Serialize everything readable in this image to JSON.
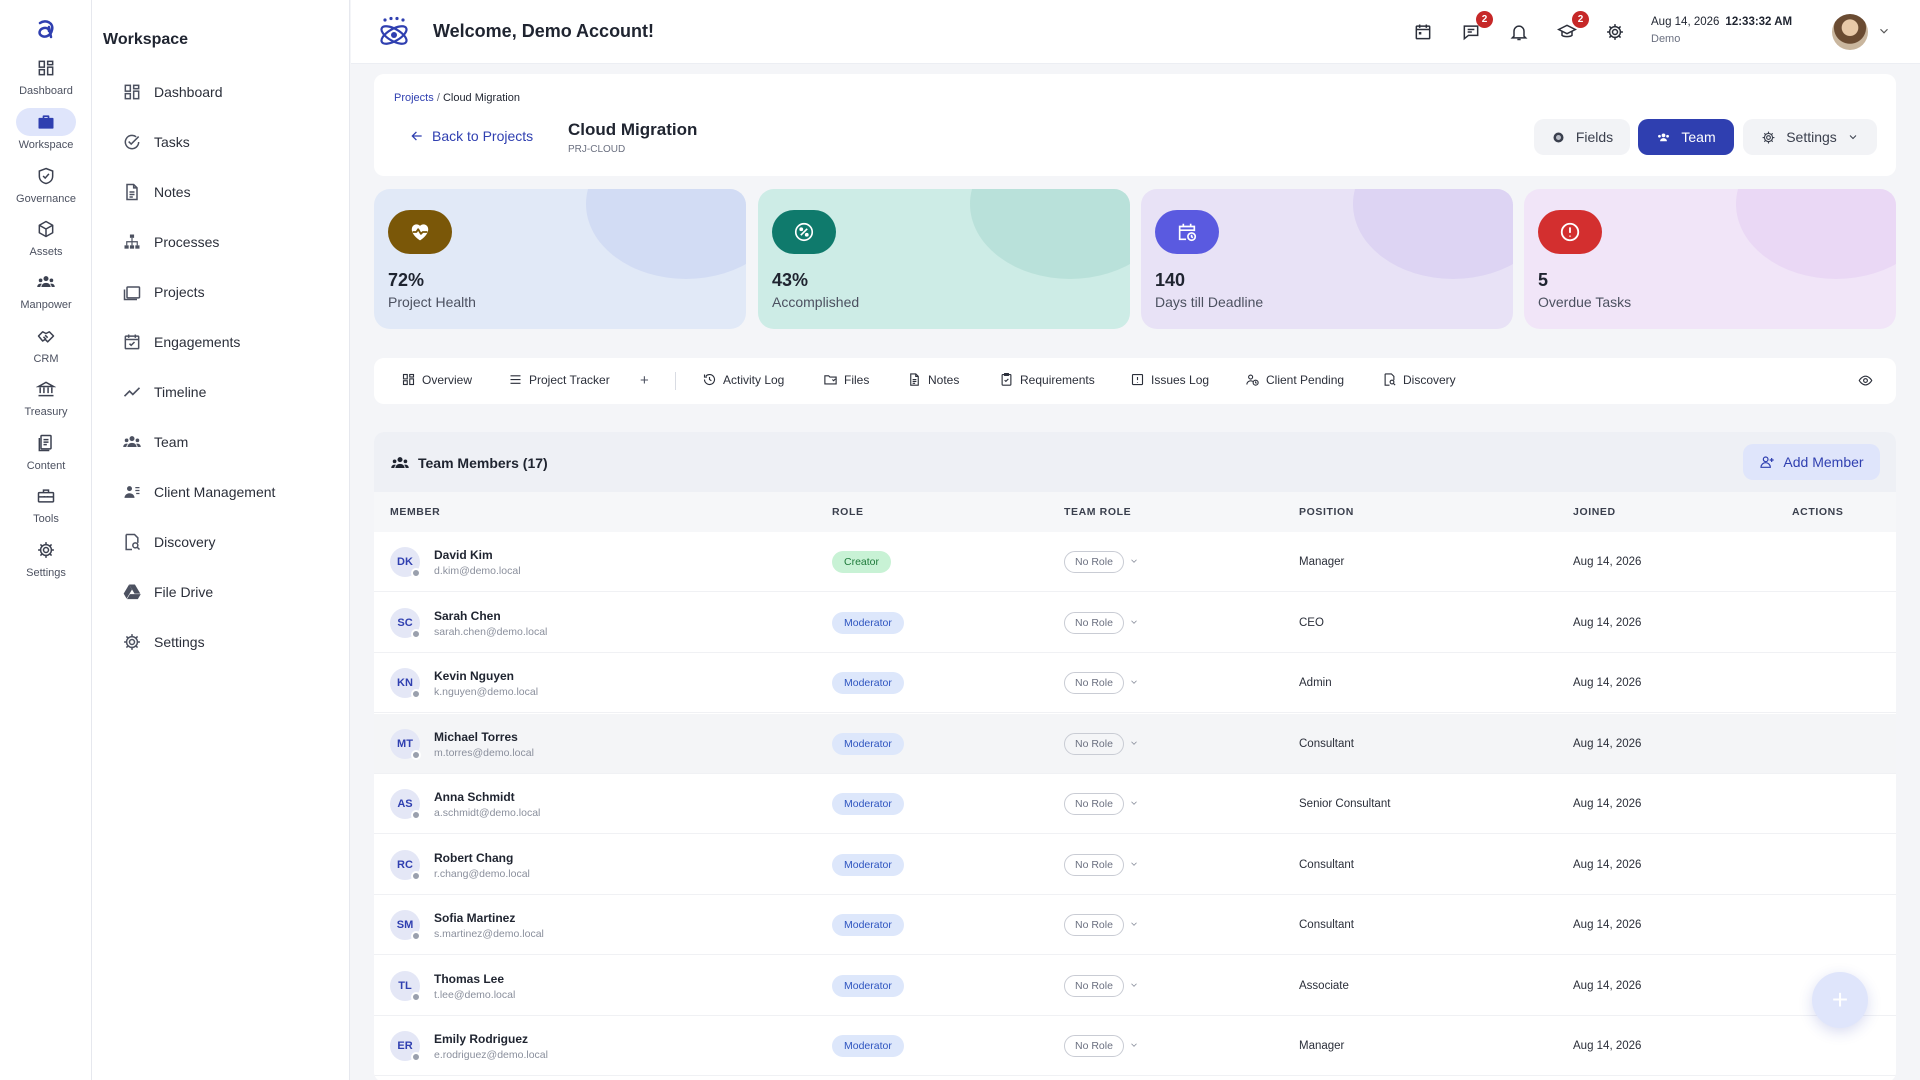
{
  "rail": {
    "items": [
      {
        "label": "Dashboard",
        "icon": "grid-icon"
      },
      {
        "label": "Workspace",
        "icon": "briefcase-icon",
        "active": true
      },
      {
        "label": "Governance",
        "icon": "shield-check-icon"
      },
      {
        "label": "Assets",
        "icon": "cube-icon"
      },
      {
        "label": "Manpower",
        "icon": "people-icon"
      },
      {
        "label": "CRM",
        "icon": "handshake-icon"
      },
      {
        "label": "Treasury",
        "icon": "bank-icon"
      },
      {
        "label": "Content",
        "icon": "document-icon"
      },
      {
        "label": "Tools",
        "icon": "toolbox-icon"
      },
      {
        "label": "Settings",
        "icon": "gear-icon"
      }
    ]
  },
  "sidebar": {
    "title": "Workspace",
    "items": [
      {
        "label": "Dashboard",
        "icon": "grid-icon"
      },
      {
        "label": "Tasks",
        "icon": "check-circle-icon"
      },
      {
        "label": "Notes",
        "icon": "note-icon"
      },
      {
        "label": "Processes",
        "icon": "hierarchy-icon"
      },
      {
        "label": "Projects",
        "icon": "folders-icon"
      },
      {
        "label": "Engagements",
        "icon": "calendar-check-icon"
      },
      {
        "label": "Timeline",
        "icon": "trend-icon"
      },
      {
        "label": "Team",
        "icon": "people-icon"
      },
      {
        "label": "Client Management",
        "icon": "client-icon"
      },
      {
        "label": "Discovery",
        "icon": "search-doc-icon"
      },
      {
        "label": "File Drive",
        "icon": "drive-icon"
      },
      {
        "label": "Settings",
        "icon": "gear-icon"
      }
    ]
  },
  "topbar": {
    "title": "Welcome, Demo Account!",
    "messages_badge": "2",
    "courses_badge": "2",
    "date": "Aug 14, 2026",
    "time": "12:33:32 AM",
    "user": "Demo"
  },
  "header": {
    "breadcrumb_root": "Projects",
    "breadcrumb_sep": "/",
    "breadcrumb_current": "Cloud Migration",
    "back_label": "Back to Projects",
    "project_title": "Cloud Migration",
    "project_code": "PRJ-CLOUD",
    "fields_label": "Fields",
    "team_label": "Team",
    "settings_label": "Settings"
  },
  "kpis": [
    {
      "value": "72%",
      "label": "Project Health",
      "bg": "#e1e9f7",
      "blob": "#c7d2f3",
      "icon_bg": "#7a5708",
      "icon": "heart-pulse-icon"
    },
    {
      "value": "43%",
      "label": "Accomplished",
      "bg": "#cdece6",
      "blob": "#a9d9cf",
      "icon_bg": "#0f7a6c",
      "icon": "percent-badge-icon"
    },
    {
      "value": "140",
      "label": "Days till Deadline",
      "bg": "#e8e2f6",
      "blob": "#d3c9f1",
      "icon_bg": "#5a5ae0",
      "icon": "calendar-clock-icon"
    },
    {
      "value": "5",
      "label": "Overdue Tasks",
      "bg": "#f1e5f8",
      "blob": "#e4cdf3",
      "icon_bg": "#d32f2f",
      "icon": "alert-circle-icon"
    }
  ],
  "tabs": [
    {
      "label": "Overview",
      "icon": "grid-icon"
    },
    {
      "label": "Project Tracker",
      "icon": "list-icon"
    },
    {
      "label": "+",
      "icon": "plus-icon"
    },
    {
      "label": "Activity Log",
      "icon": "history-icon"
    },
    {
      "label": "Files",
      "icon": "folder-icon"
    },
    {
      "label": "Notes",
      "icon": "note-icon"
    },
    {
      "label": "Requirements",
      "icon": "clipboard-icon"
    },
    {
      "label": "Issues Log",
      "icon": "issue-icon"
    },
    {
      "label": "Client Pending",
      "icon": "client-pending-icon"
    },
    {
      "label": "Discovery",
      "icon": "search-doc-icon"
    }
  ],
  "team": {
    "title": "Team Members (17)",
    "add_label": "Add Member",
    "columns": {
      "member": "MEMBER",
      "role": "ROLE",
      "team_role": "TEAM ROLE",
      "position": "POSITION",
      "joined": "JOINED",
      "actions": "ACTIONS"
    },
    "rows": [
      {
        "initials": "DK",
        "name": "David Kim",
        "email": "d.kim@demo.local",
        "role": "Creator",
        "role_type": "creator",
        "team_role": "No Role",
        "position": "Manager",
        "joined": "Aug 14, 2026"
      },
      {
        "initials": "SC",
        "name": "Sarah Chen",
        "email": "sarah.chen@demo.local",
        "role": "Moderator",
        "role_type": "mod",
        "team_role": "No Role",
        "position": "CEO",
        "joined": "Aug 14, 2026"
      },
      {
        "initials": "KN",
        "name": "Kevin Nguyen",
        "email": "k.nguyen@demo.local",
        "role": "Moderator",
        "role_type": "mod",
        "team_role": "No Role",
        "position": "Admin",
        "joined": "Aug 14, 2026"
      },
      {
        "initials": "MT",
        "name": "Michael Torres",
        "email": "m.torres@demo.local",
        "role": "Moderator",
        "role_type": "mod",
        "team_role": "No Role",
        "position": "Consultant",
        "joined": "Aug 14, 2026",
        "highlight": true
      },
      {
        "initials": "AS",
        "name": "Anna Schmidt",
        "email": "a.schmidt@demo.local",
        "role": "Moderator",
        "role_type": "mod",
        "team_role": "No Role",
        "position": "Senior Consultant",
        "joined": "Aug 14, 2026"
      },
      {
        "initials": "RC",
        "name": "Robert Chang",
        "email": "r.chang@demo.local",
        "role": "Moderator",
        "role_type": "mod",
        "team_role": "No Role",
        "position": "Consultant",
        "joined": "Aug 14, 2026"
      },
      {
        "initials": "SM",
        "name": "Sofia Martinez",
        "email": "s.martinez@demo.local",
        "role": "Moderator",
        "role_type": "mod",
        "team_role": "No Role",
        "position": "Consultant",
        "joined": "Aug 14, 2026"
      },
      {
        "initials": "TL",
        "name": "Thomas Lee",
        "email": "t.lee@demo.local",
        "role": "Moderator",
        "role_type": "mod",
        "team_role": "No Role",
        "position": "Associate",
        "joined": "Aug 14, 2026"
      },
      {
        "initials": "ER",
        "name": "Emily Rodriguez",
        "email": "e.rodriguez@demo.local",
        "role": "Moderator",
        "role_type": "mod",
        "team_role": "No Role",
        "position": "Manager",
        "joined": "Aug 14, 2026"
      }
    ]
  },
  "fab_label": "+",
  "colors": {
    "accent": "#2f3fb0",
    "accent_soft": "#dfe5fb"
  }
}
